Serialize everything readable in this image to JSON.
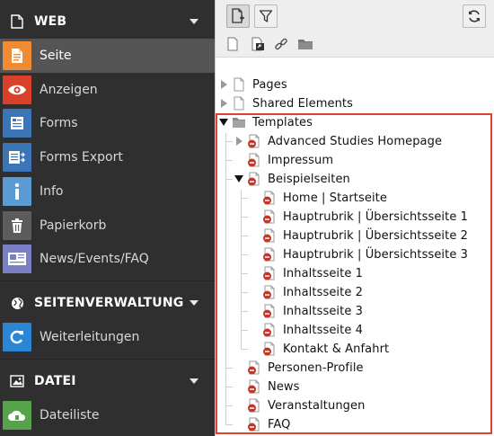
{
  "colors": {
    "sidebar_bg": "#2f2f2f",
    "sidebar_active": "#555555",
    "highlight_frame": "#e2412f",
    "page_icon_badge": "#c63528"
  },
  "sidebar": {
    "groups": [
      {
        "title": "WEB",
        "icon": "document-icon",
        "modules": [
          {
            "label": "Seite",
            "icon": "page-module-icon",
            "color": "#f08a33",
            "active": true
          },
          {
            "label": "Anzeigen",
            "icon": "eye-icon",
            "color": "#d9412a"
          },
          {
            "label": "Forms",
            "icon": "forms-icon",
            "color": "#3c75b5"
          },
          {
            "label": "Forms Export",
            "icon": "forms-export-icon",
            "color": "#3c75b5"
          },
          {
            "label": "Info",
            "icon": "info-icon",
            "color": "#5b9bd5"
          },
          {
            "label": "Papierkorb",
            "icon": "trash-icon",
            "color": "#5c5c5c"
          },
          {
            "label": "News/Events/FAQ",
            "icon": "news-icon",
            "color": "#7b7fc4"
          }
        ]
      },
      {
        "title": "SEITENVERWALTUNG",
        "icon": "globe-icon",
        "modules": [
          {
            "label": "Weiterleitungen",
            "icon": "redirect-icon",
            "color": "#2b87d6"
          }
        ]
      },
      {
        "title": "DATEI",
        "icon": "image-icon",
        "modules": [
          {
            "label": "Dateiliste",
            "icon": "cloud-files-icon",
            "color": "#56a34b"
          }
        ]
      }
    ]
  },
  "toolbar": {
    "new_page_icon": "new-page-icon",
    "filter_icon": "filter-icon",
    "refresh_icon": "refresh-icon",
    "drag_icons": [
      "new-page-drag-icon",
      "new-shortcut-drag-icon",
      "new-link-drag-icon",
      "new-folder-drag-icon"
    ]
  },
  "tree": {
    "nodes": [
      {
        "label": "Pages",
        "level": 0,
        "toggle": "collapsed",
        "icon": "page-grey"
      },
      {
        "label": "Shared Elements",
        "level": 0,
        "toggle": "collapsed",
        "icon": "page-grey"
      },
      {
        "label": "Templates",
        "level": 0,
        "toggle": "expanded",
        "icon": "folder-grey"
      },
      {
        "label": "Advanced Studies Homepage",
        "level": 1,
        "toggle": "collapsed",
        "icon": "page-hidden"
      },
      {
        "label": "Impressum",
        "level": 1,
        "toggle": "none",
        "icon": "page-hidden"
      },
      {
        "label": "Beispielseiten",
        "level": 1,
        "toggle": "expanded",
        "icon": "page-hidden"
      },
      {
        "label": "Home | Startseite",
        "level": 2,
        "toggle": "none",
        "icon": "page-hidden"
      },
      {
        "label": "Hauptrubrik | Übersichtsseite 1",
        "level": 2,
        "toggle": "none",
        "icon": "page-hidden"
      },
      {
        "label": "Hauptrubrik | Übersichtsseite 2",
        "level": 2,
        "toggle": "none",
        "icon": "page-hidden"
      },
      {
        "label": "Hauptrubrik | Übersichtsseite 3",
        "level": 2,
        "toggle": "none",
        "icon": "page-hidden"
      },
      {
        "label": "Inhaltsseite 1",
        "level": 2,
        "toggle": "none",
        "icon": "page-hidden"
      },
      {
        "label": "Inhaltsseite 2",
        "level": 2,
        "toggle": "none",
        "icon": "page-hidden"
      },
      {
        "label": "Inhaltsseite 3",
        "level": 2,
        "toggle": "none",
        "icon": "page-hidden"
      },
      {
        "label": "Inhaltsseite 4",
        "level": 2,
        "toggle": "none",
        "icon": "page-hidden"
      },
      {
        "label": "Kontakt & Anfahrt",
        "level": 2,
        "toggle": "none",
        "icon": "page-hidden"
      },
      {
        "label": "Personen-Profile",
        "level": 1,
        "toggle": "none",
        "icon": "page-hidden"
      },
      {
        "label": "News",
        "level": 1,
        "toggle": "none",
        "icon": "page-hidden"
      },
      {
        "label": "Veranstaltungen",
        "level": 1,
        "toggle": "none",
        "icon": "page-hidden"
      },
      {
        "label": "FAQ",
        "level": 1,
        "toggle": "none",
        "icon": "page-hidden"
      }
    ]
  }
}
